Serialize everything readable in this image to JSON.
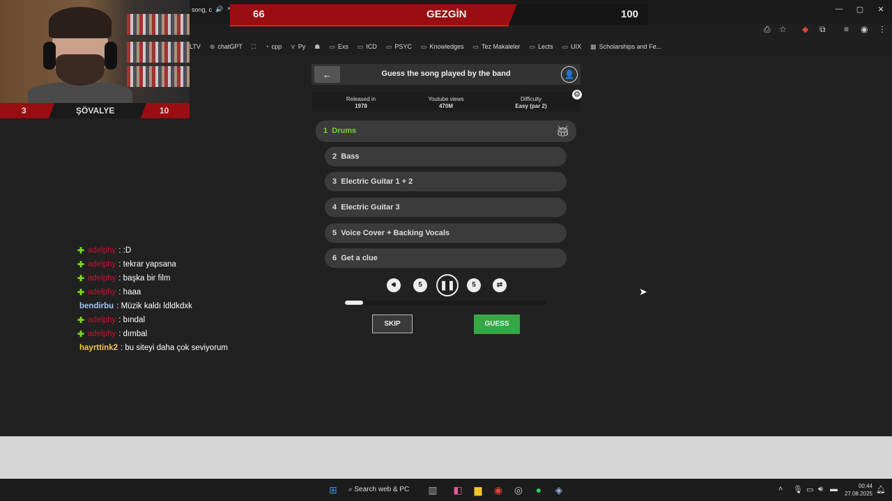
{
  "browser": {
    "tab_title": "song, c",
    "tab_audio_icon": "speaker-icon",
    "tab_close": "×",
    "window_buttons": [
      "—",
      "▢",
      "✕"
    ],
    "toolbar_icons": [
      "install-icon",
      "star-icon",
      "extension-red-icon",
      "puzzle-icon",
      "media-icon",
      "profile-icon",
      "menu-icon"
    ],
    "bookmarks": [
      {
        "label": "LTV",
        "icon": ""
      },
      {
        "label": "chatGPT",
        "icon": "⊛"
      },
      {
        "label": "",
        "icon": "⛶"
      },
      {
        "label": "cpp",
        "icon": "◔"
      },
      {
        "label": "Py",
        "icon": "⋎"
      },
      {
        "label": "",
        "icon": "☗"
      },
      {
        "label": "Exs",
        "icon": "▭"
      },
      {
        "label": "ICD",
        "icon": "▭"
      },
      {
        "label": "PSYC",
        "icon": "▭"
      },
      {
        "label": "Knowledges",
        "icon": "▭"
      },
      {
        "label": "Tez Makaleler",
        "icon": "▭"
      },
      {
        "label": "Lects",
        "icon": "▭"
      },
      {
        "label": "UIX",
        "icon": "▭"
      },
      {
        "label": "Scholarships and Fe...",
        "icon": "▦"
      }
    ]
  },
  "banner": {
    "left_score": "66",
    "title": "GEZGİN",
    "right_score": "100"
  },
  "webcam": {
    "left": "3",
    "title": "ŞÖVALYE",
    "right": "10"
  },
  "chat": [
    {
      "badge": true,
      "user": "adelphy",
      "color": "#c8102e",
      "msg": ": :D"
    },
    {
      "badge": true,
      "user": "adelphy",
      "color": "#c8102e",
      "msg": ": tekrar yapsana"
    },
    {
      "badge": true,
      "user": "adelphy",
      "color": "#c8102e",
      "msg": ": başka bir film"
    },
    {
      "badge": true,
      "user": "adelphy",
      "color": "#c8102e",
      "msg": ": haaa"
    },
    {
      "badge": false,
      "user": "bendirbu",
      "color": "#9ec5f5",
      "msg": ": Müzik kaldı ldldkdxk"
    },
    {
      "badge": true,
      "user": "adelphy",
      "color": "#c8102e",
      "msg": ": bındal"
    },
    {
      "badge": true,
      "user": "adelphy",
      "color": "#c8102e",
      "msg": ": dımbal"
    },
    {
      "badge": false,
      "user": "hayrttink2",
      "color": "#f5c542",
      "msg": ": bu siteyi daha çok seviyorum"
    }
  ],
  "game": {
    "back_icon": "←",
    "title": "Guess the song played by the band",
    "profile_icon": "👤",
    "settings_icon": "⚙",
    "stats": [
      {
        "label": "Released in",
        "value": "1978"
      },
      {
        "label": "Youtube views",
        "value": "470M"
      },
      {
        "label": "Difficulty",
        "value": "Easy (par 2)"
      }
    ],
    "tracks": [
      {
        "num": "1",
        "label": "Drums",
        "active": true,
        "icon": "drum-kit-icon"
      },
      {
        "num": "2",
        "label": "Bass",
        "active": false
      },
      {
        "num": "3",
        "label": "Electric Guitar 1 + 2",
        "active": false
      },
      {
        "num": "4",
        "label": "Electric Guitar 3",
        "active": false
      },
      {
        "num": "5",
        "label": "Voice Cover + Backing Vocals",
        "active": false
      },
      {
        "num": "6",
        "label": "Get a clue",
        "active": false
      }
    ],
    "controls": {
      "rewind_seconds": "5",
      "forward_seconds": "5",
      "state": "playing"
    },
    "progress": 0.09,
    "skip_label": "SKIP",
    "guess_label": "GUESS",
    "colors": {
      "active_track": "#7bd13a",
      "guess_button": "#35a845"
    }
  },
  "taskbar": {
    "search_label": "Search web & PC",
    "time": "00:44",
    "date": "27.08.2025"
  }
}
